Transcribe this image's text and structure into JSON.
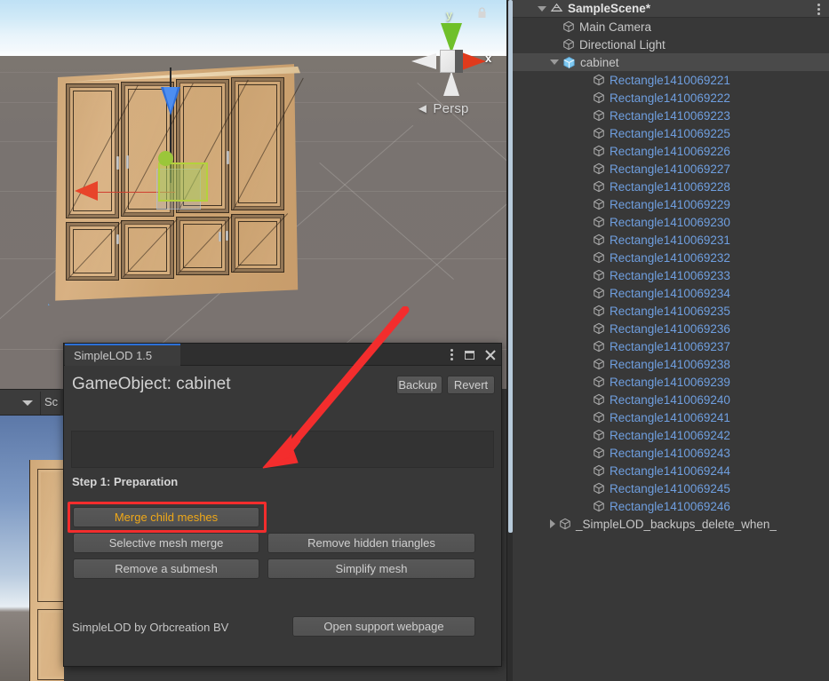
{
  "scene_view": {
    "gizmo": {
      "axis_y_label": "y",
      "axis_x_label": "x",
      "projection_label": "◄ Persp",
      "lock_icon": "lock-icon"
    },
    "object_name": "cabinet"
  },
  "left_toolbar": {
    "dropdown_icon": "chevron-down-icon",
    "label": "Sc"
  },
  "lod_window": {
    "tab_title": "SimpleLOD 1.5",
    "window_buttons": {
      "menu_icon": "kebab-menu-icon",
      "maximize_icon": "maximize-icon",
      "close_icon": "close-icon"
    },
    "gameobject_label": "GameObject: cabinet",
    "backup_label": "Backup",
    "revert_label": "Revert",
    "log_text": "",
    "step1_label": "Step 1: Preparation",
    "buttons": {
      "merge_child_meshes": "Merge child meshes",
      "selective_mesh_merge": "Selective mesh merge",
      "remove_a_submesh": "Remove a submesh",
      "remove_hidden_triangles": "Remove hidden triangles",
      "simplify_mesh": "Simplify mesh",
      "open_support_webpage": "Open support webpage"
    },
    "credit_label": "SimpleLOD by Orbcreation BV",
    "highlight_color": "#f32d2d",
    "highlighted_button_text_color": "#f0a818"
  },
  "annotation": {
    "arrow_color": "#f32d2d",
    "points_to": "merge-child-meshes-button"
  },
  "hierarchy": {
    "menu_icon": "kebab-menu-icon",
    "rows": [
      {
        "label": "SampleScene*",
        "depth": 1,
        "icon": "scene-icon",
        "fold": "open",
        "style": "scene",
        "selected": false
      },
      {
        "label": "Main Camera",
        "depth": 2,
        "icon": "gameobject-icon",
        "fold": "none",
        "style": "plain",
        "selected": false
      },
      {
        "label": "Directional Light",
        "depth": 2,
        "icon": "gameobject-icon",
        "fold": "none",
        "style": "plain",
        "selected": false
      },
      {
        "label": "cabinet",
        "depth": 2,
        "icon": "prefab-icon",
        "fold": "open",
        "style": "plain",
        "selected": true
      },
      {
        "label": "Rectangle1410069221",
        "depth": 3,
        "icon": "gameobject-icon",
        "fold": "none",
        "style": "blue",
        "selected": false
      },
      {
        "label": "Rectangle1410069222",
        "depth": 3,
        "icon": "gameobject-icon",
        "fold": "none",
        "style": "blue",
        "selected": false
      },
      {
        "label": "Rectangle1410069223",
        "depth": 3,
        "icon": "gameobject-icon",
        "fold": "none",
        "style": "blue",
        "selected": false
      },
      {
        "label": "Rectangle1410069225",
        "depth": 3,
        "icon": "gameobject-icon",
        "fold": "none",
        "style": "blue",
        "selected": false
      },
      {
        "label": "Rectangle1410069226",
        "depth": 3,
        "icon": "gameobject-icon",
        "fold": "none",
        "style": "blue",
        "selected": false
      },
      {
        "label": "Rectangle1410069227",
        "depth": 3,
        "icon": "gameobject-icon",
        "fold": "none",
        "style": "blue",
        "selected": false
      },
      {
        "label": "Rectangle1410069228",
        "depth": 3,
        "icon": "gameobject-icon",
        "fold": "none",
        "style": "blue",
        "selected": false
      },
      {
        "label": "Rectangle1410069229",
        "depth": 3,
        "icon": "gameobject-icon",
        "fold": "none",
        "style": "blue",
        "selected": false
      },
      {
        "label": "Rectangle1410069230",
        "depth": 3,
        "icon": "gameobject-icon",
        "fold": "none",
        "style": "blue",
        "selected": false
      },
      {
        "label": "Rectangle1410069231",
        "depth": 3,
        "icon": "gameobject-icon",
        "fold": "none",
        "style": "blue",
        "selected": false
      },
      {
        "label": "Rectangle1410069232",
        "depth": 3,
        "icon": "gameobject-icon",
        "fold": "none",
        "style": "blue",
        "selected": false
      },
      {
        "label": "Rectangle1410069233",
        "depth": 3,
        "icon": "gameobject-icon",
        "fold": "none",
        "style": "blue",
        "selected": false
      },
      {
        "label": "Rectangle1410069234",
        "depth": 3,
        "icon": "gameobject-icon",
        "fold": "none",
        "style": "blue",
        "selected": false
      },
      {
        "label": "Rectangle1410069235",
        "depth": 3,
        "icon": "gameobject-icon",
        "fold": "none",
        "style": "blue",
        "selected": false
      },
      {
        "label": "Rectangle1410069236",
        "depth": 3,
        "icon": "gameobject-icon",
        "fold": "none",
        "style": "blue",
        "selected": false
      },
      {
        "label": "Rectangle1410069237",
        "depth": 3,
        "icon": "gameobject-icon",
        "fold": "none",
        "style": "blue",
        "selected": false
      },
      {
        "label": "Rectangle1410069238",
        "depth": 3,
        "icon": "gameobject-icon",
        "fold": "none",
        "style": "blue",
        "selected": false
      },
      {
        "label": "Rectangle1410069239",
        "depth": 3,
        "icon": "gameobject-icon",
        "fold": "none",
        "style": "blue",
        "selected": false
      },
      {
        "label": "Rectangle1410069240",
        "depth": 3,
        "icon": "gameobject-icon",
        "fold": "none",
        "style": "blue",
        "selected": false
      },
      {
        "label": "Rectangle1410069241",
        "depth": 3,
        "icon": "gameobject-icon",
        "fold": "none",
        "style": "blue",
        "selected": false
      },
      {
        "label": "Rectangle1410069242",
        "depth": 3,
        "icon": "gameobject-icon",
        "fold": "none",
        "style": "blue",
        "selected": false
      },
      {
        "label": "Rectangle1410069243",
        "depth": 3,
        "icon": "gameobject-icon",
        "fold": "none",
        "style": "blue",
        "selected": false
      },
      {
        "label": "Rectangle1410069244",
        "depth": 3,
        "icon": "gameobject-icon",
        "fold": "none",
        "style": "blue",
        "selected": false
      },
      {
        "label": "Rectangle1410069245",
        "depth": 3,
        "icon": "gameobject-icon",
        "fold": "none",
        "style": "blue",
        "selected": false
      },
      {
        "label": "Rectangle1410069246",
        "depth": 3,
        "icon": "gameobject-icon",
        "fold": "none",
        "style": "blue",
        "selected": false
      },
      {
        "label": "_SimpleLOD_backups_delete_when_",
        "depth": 2,
        "icon": "gameobject-icon",
        "fold": "closed",
        "style": "plain",
        "selected": false
      }
    ]
  }
}
